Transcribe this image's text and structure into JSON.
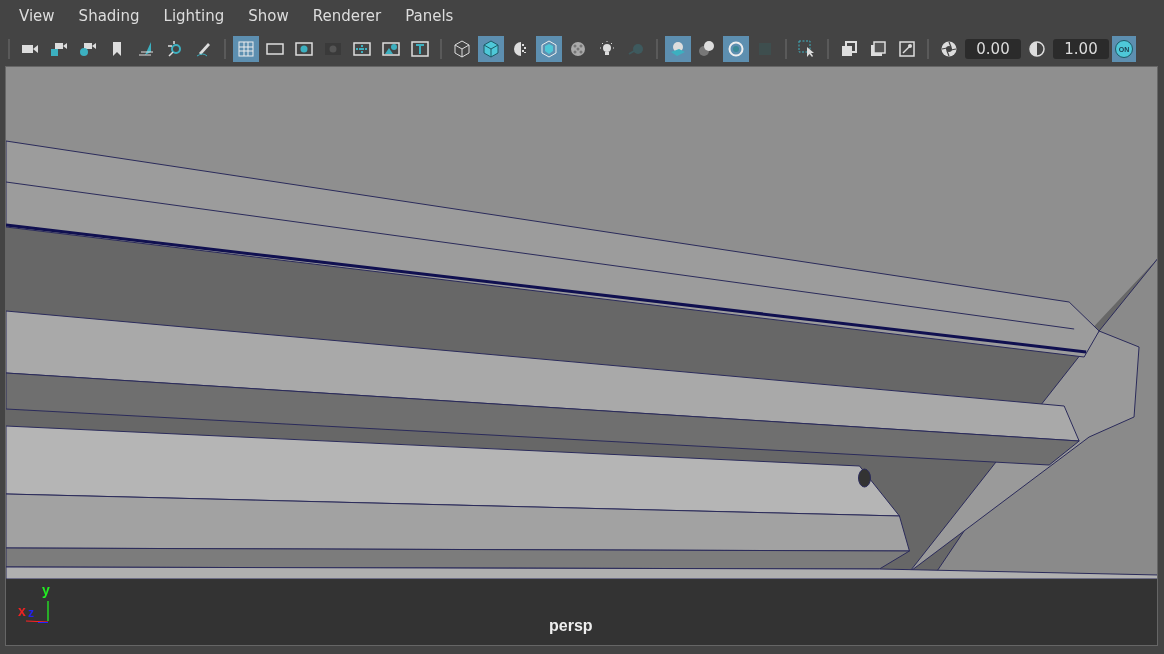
{
  "menu": [
    "View",
    "Shading",
    "Lighting",
    "Show",
    "Renderer",
    "Panels"
  ],
  "toolbar": [
    [
      {
        "kind": "camera",
        "selected": false
      },
      {
        "kind": "camlock",
        "selected": false
      },
      {
        "kind": "camgear",
        "selected": false
      },
      {
        "kind": "bookmark",
        "selected": false
      },
      {
        "kind": "plane",
        "selected": false
      },
      {
        "kind": "zoom",
        "selected": false
      },
      {
        "kind": "pencil",
        "selected": false
      }
    ],
    [
      {
        "kind": "grid",
        "selected": true
      },
      {
        "kind": "film",
        "selected": false
      },
      {
        "kind": "dot",
        "selected": false
      },
      {
        "kind": "darkdot",
        "selected": false
      },
      {
        "kind": "fields",
        "selected": false
      },
      {
        "kind": "shapes",
        "selected": false
      },
      {
        "kind": "text",
        "selected": false
      }
    ],
    [
      {
        "kind": "wirecube",
        "selected": false
      },
      {
        "kind": "cube",
        "selected": true
      },
      {
        "kind": "halfsphere",
        "selected": false
      },
      {
        "kind": "framecube",
        "selected": true
      },
      {
        "kind": "checker",
        "selected": false
      },
      {
        "kind": "bulb",
        "selected": false
      },
      {
        "kind": "shadow",
        "selected": false
      }
    ],
    [
      {
        "kind": "ambient",
        "selected": true
      },
      {
        "kind": "spheres",
        "selected": false
      },
      {
        "kind": "ring",
        "selected": true
      },
      {
        "kind": "square",
        "selected": false
      }
    ],
    [
      {
        "kind": "select",
        "selected": false
      }
    ],
    [
      {
        "kind": "isolate",
        "selected": false
      },
      {
        "kind": "xray",
        "selected": false
      },
      {
        "kind": "image",
        "selected": false
      }
    ],
    [
      {
        "kind": "aperture",
        "selected": false
      },
      {
        "kind": "field",
        "value": "0.00"
      },
      {
        "kind": "halfcircle",
        "selected": false
      },
      {
        "kind": "field",
        "value": "1.00"
      },
      {
        "kind": "on",
        "label": "ON",
        "selected": true
      }
    ]
  ],
  "axes": {
    "x": "x",
    "y": "y",
    "z": "z"
  },
  "camera_label": "persp"
}
